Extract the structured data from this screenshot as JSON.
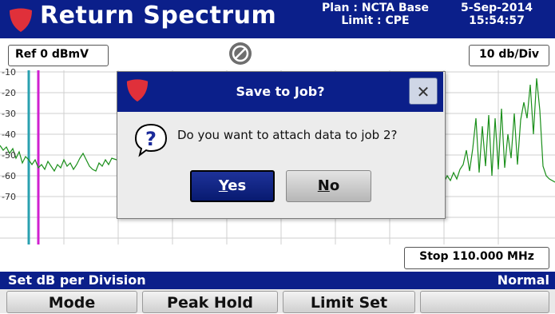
{
  "header": {
    "title": "Return Spectrum",
    "plan_line1": "Plan : NCTA Base",
    "plan_line2": "Limit : CPE",
    "date": "5-Sep-2014",
    "time": "15:54:57",
    "logo_icon": "shield-logo-icon"
  },
  "controls": {
    "ref_label": "Ref 0 dBmV",
    "scale_label": "10 db/Div",
    "stop_label": "Stop 110.000 MHz",
    "pause_icon": "no-sign-icon"
  },
  "graph": {
    "y_ticks": [
      "-10",
      "-20",
      "-30",
      "-40",
      "-50",
      "-60",
      "-70"
    ],
    "trace_color": "#1a8f1a",
    "marker_colors": [
      "#2aa0b0",
      "#d020d0"
    ]
  },
  "status": {
    "left": "Set dB per Division",
    "right": "Normal"
  },
  "softkeys": [
    "Mode",
    "Peak Hold",
    "Limit Set",
    ""
  ],
  "dialog": {
    "title": "Save to Job?",
    "message": "Do you want to attach data to job 2?",
    "yes_key": "Y",
    "yes_rest": "es",
    "no_key": "N",
    "no_rest": "o",
    "close_icon": "close-icon",
    "question_icon": "question-icon"
  },
  "colors": {
    "header_bg": "#0b1f8a",
    "accent_red": "#e0303a"
  }
}
